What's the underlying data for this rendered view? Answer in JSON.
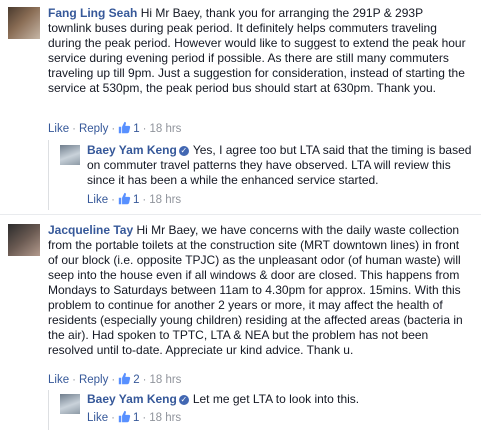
{
  "comments": [
    {
      "author": "Fang Ling Seah",
      "text": "Hi Mr Baey, thank you for arranging the 291P & 293P townlink buses during peak period. It definitely helps commuters traveling during the peak period. However would like to suggest to extend the peak hour service during evening period if possible. As there are still many commuters traveling up till 9pm. Just a suggestion for consideration, instead of starting the service at 530pm, the peak period bus should start at 630pm. Thank you.",
      "actions": {
        "like": "Like",
        "reply": "Reply",
        "likes": "1",
        "time": "18 hrs"
      },
      "reply": {
        "author": "Baey Yam Keng",
        "text": "Yes, I agree too but LTA said that the timing is based on commuter travel patterns they have observed. LTA will review this since it has been a while the enhanced service started.",
        "actions": {
          "like": "Like",
          "likes": "1",
          "time": "18 hrs"
        }
      }
    },
    {
      "author": "Jacqueline Tay",
      "text": "Hi Mr Baey, we have concerns with the daily waste collection from the portable toilets at the construction site (MRT downtown lines) in front of our block (i.e. opposite TPJC) as the unpleasant odor (of human waste) will seep into the house even if all windows & door are closed. This happens from Mondays to Saturdays between 11am to 4.30pm for approx. 15mins. With this problem to continue for another 2 years or more, it may affect the health of residents (especially young children) residing at the affected areas (bacteria in the air). Had spoken to TPTC, LTA & NEA but the problem has not been resolved until to-date. Appreciate ur kind advice. Thank u.",
      "actions": {
        "like": "Like",
        "reply": "Reply",
        "likes": "2",
        "time": "18 hrs"
      },
      "reply": {
        "author": "Baey Yam Keng",
        "text": "Let me get LTA to look into this.",
        "actions": {
          "like": "Like",
          "likes": "1",
          "time": "18 hrs"
        }
      }
    }
  ]
}
